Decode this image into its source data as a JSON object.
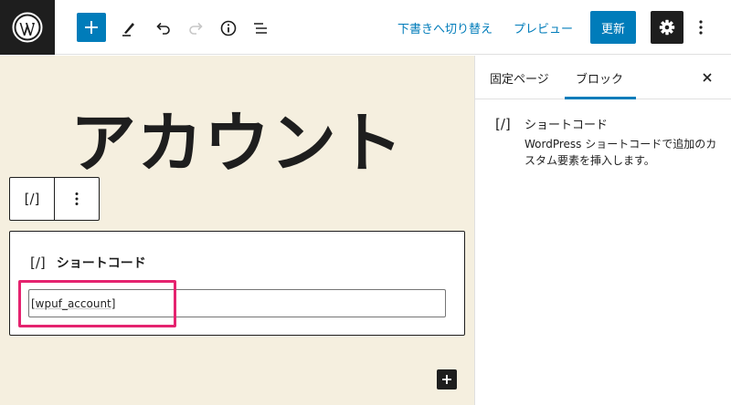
{
  "toolbar": {
    "switch_to_draft": "下書きへ切り替え",
    "preview": "プレビュー",
    "update": "更新"
  },
  "editor": {
    "page_title": "アカウント",
    "block_toolbar": {
      "type_icon": "[/]"
    },
    "shortcode_block": {
      "icon": "[/]",
      "title": "ショートコード",
      "value": "[wpuf_account]"
    }
  },
  "sidebar": {
    "tabs": [
      {
        "label": "固定ページ"
      },
      {
        "label": "ブロック"
      }
    ],
    "block_card": {
      "icon": "[/]",
      "title": "ショートコード",
      "description": "WordPress ショートコードで追加のカスタム要素を挿入します。"
    }
  },
  "colors": {
    "accent": "#007cba",
    "dark": "#1e1e1e",
    "canvas_bg": "#f5efdf",
    "highlight": "#e5236f"
  },
  "icons": [
    "wordpress-logo-icon",
    "plus-icon",
    "pencil-icon",
    "undo-icon",
    "redo-icon",
    "info-icon",
    "list-view-icon",
    "gear-icon",
    "kebab-icon",
    "close-icon"
  ]
}
